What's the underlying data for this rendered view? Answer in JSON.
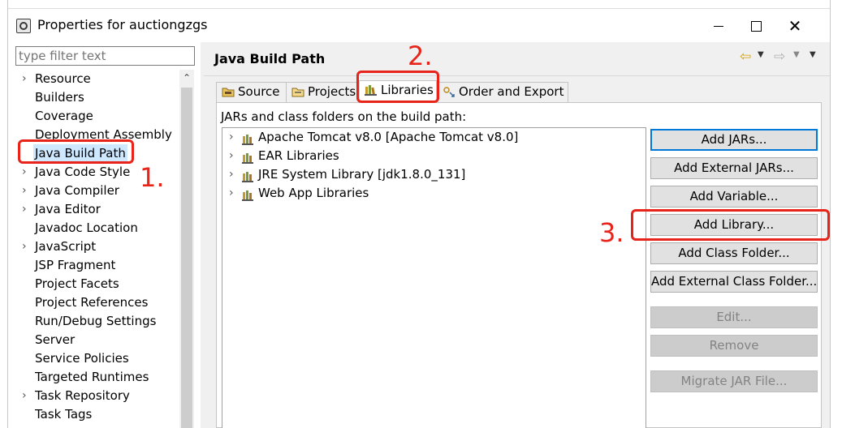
{
  "window": {
    "title": "Properties for auctiongzgs",
    "minimize_label": "",
    "maximize_label": "",
    "close_label": "✕"
  },
  "filter": {
    "placeholder": "type filter text"
  },
  "tree": {
    "items": [
      {
        "label": "Resource",
        "expandable": true
      },
      {
        "label": "Builders",
        "expandable": false
      },
      {
        "label": "Coverage",
        "expandable": false
      },
      {
        "label": "Deployment Assembly",
        "expandable": false
      },
      {
        "label": "Java Build Path",
        "expandable": false,
        "selected": true
      },
      {
        "label": "Java Code Style",
        "expandable": true
      },
      {
        "label": "Java Compiler",
        "expandable": true
      },
      {
        "label": "Java Editor",
        "expandable": true
      },
      {
        "label": "Javadoc Location",
        "expandable": false
      },
      {
        "label": "JavaScript",
        "expandable": true
      },
      {
        "label": "JSP Fragment",
        "expandable": false
      },
      {
        "label": "Project Facets",
        "expandable": false
      },
      {
        "label": "Project References",
        "expandable": false
      },
      {
        "label": "Run/Debug Settings",
        "expandable": false
      },
      {
        "label": "Server",
        "expandable": false
      },
      {
        "label": "Service Policies",
        "expandable": false
      },
      {
        "label": "Targeted Runtimes",
        "expandable": false
      },
      {
        "label": "Task Repository",
        "expandable": true
      },
      {
        "label": "Task Tags",
        "expandable": false
      }
    ]
  },
  "page": {
    "title": "Java Build Path"
  },
  "tabs": {
    "source": "Source",
    "projects": "Projects",
    "libraries": "Libraries",
    "order": "Order and Export"
  },
  "libraries": {
    "label": "JARs and class folders on the build path:",
    "items": [
      "Apache Tomcat v8.0 [Apache Tomcat v8.0]",
      "EAR Libraries",
      "JRE System Library [jdk1.8.0_131]",
      "Web App Libraries"
    ]
  },
  "buttons": {
    "add_jars": "Add JARs...",
    "add_external_jars": "Add External JARs...",
    "add_variable": "Add Variable...",
    "add_library": "Add Library...",
    "add_class_folder": "Add Class Folder...",
    "add_external_class_folder": "Add External Class Folder...",
    "edit": "Edit...",
    "remove": "Remove",
    "migrate": "Migrate JAR File..."
  },
  "annotations": {
    "step1": "1.",
    "step2": "2.",
    "step3": "3."
  },
  "colors": {
    "annotation_red": "#e8231a",
    "selection_blue": "#cde8ff",
    "focus_blue": "#0078d7"
  }
}
